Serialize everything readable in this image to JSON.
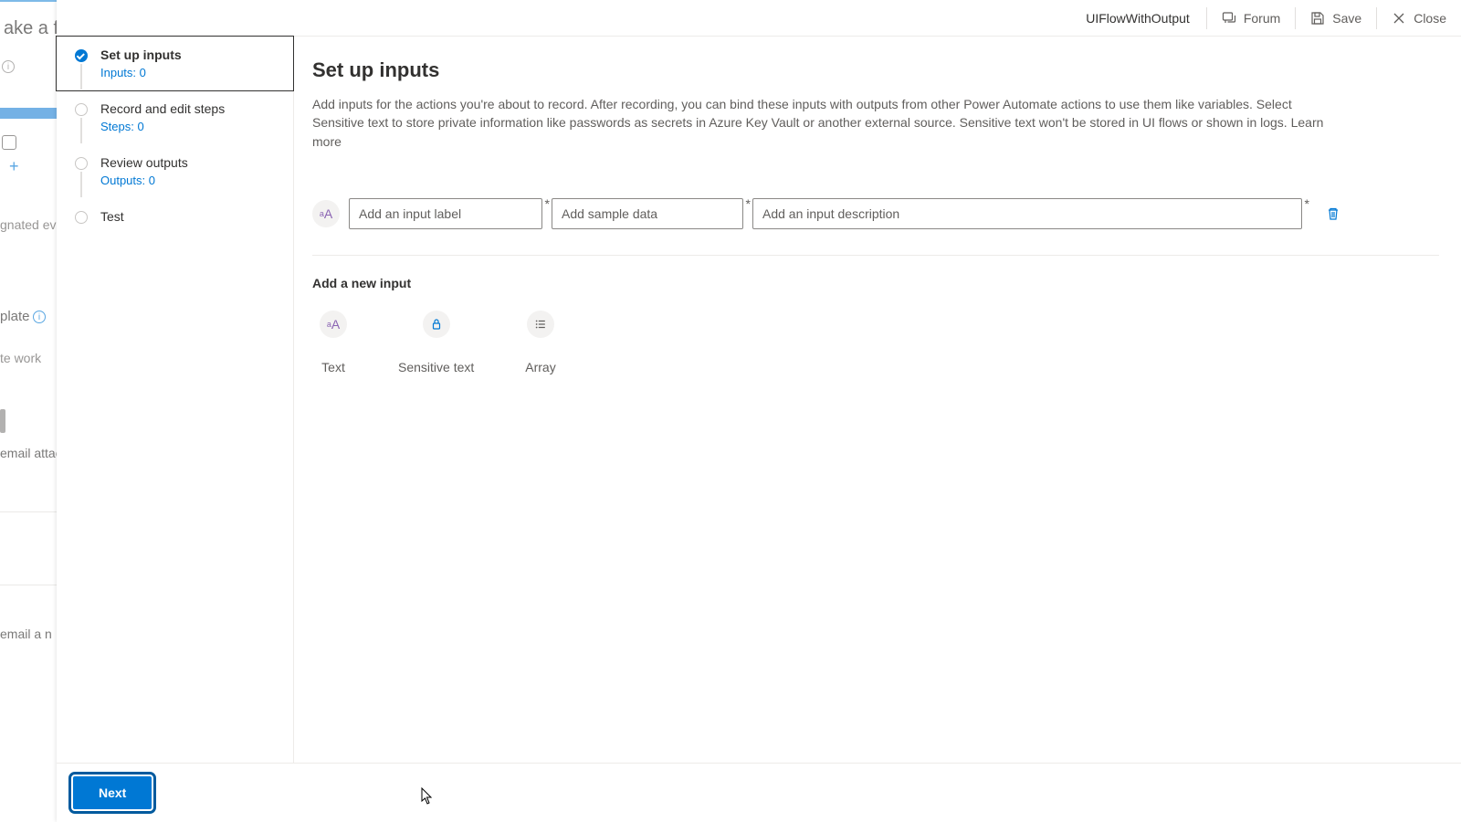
{
  "background": {
    "partial_title": "ake a fl",
    "texts": {
      "gnated": "gnated even",
      "plate": "plate",
      "tework": "te work",
      "emailattac": "email attac",
      "emailn": "email a n"
    }
  },
  "header": {
    "flow_name": "UIFlowWithOutput",
    "forum": "Forum",
    "save": "Save",
    "close": "Close"
  },
  "steps": {
    "s1": {
      "title": "Set up inputs",
      "sub": "Inputs: 0"
    },
    "s2": {
      "title": "Record and edit steps",
      "sub": "Steps: 0"
    },
    "s3": {
      "title": "Review outputs",
      "sub": "Outputs: 0"
    },
    "s4": {
      "title": "Test"
    }
  },
  "content": {
    "title": "Set up inputs",
    "description": "Add inputs for the actions you're about to record. After recording, you can bind these inputs with outputs from other Power Automate actions to use them like variables. Select Sensitive text to store private information like passwords as secrets in Azure Key Vault or another external source. Sensitive text won't be stored in UI flows or shown in logs. ",
    "learn_more": "Learn more",
    "input_row": {
      "label_placeholder": "Add an input label",
      "sample_placeholder": "Add sample data",
      "desc_placeholder": "Add an input description"
    },
    "add_new": "Add a new input",
    "types": {
      "text": "Text",
      "sensitive": "Sensitive text",
      "array": "Array"
    }
  },
  "footer": {
    "next": "Next"
  }
}
